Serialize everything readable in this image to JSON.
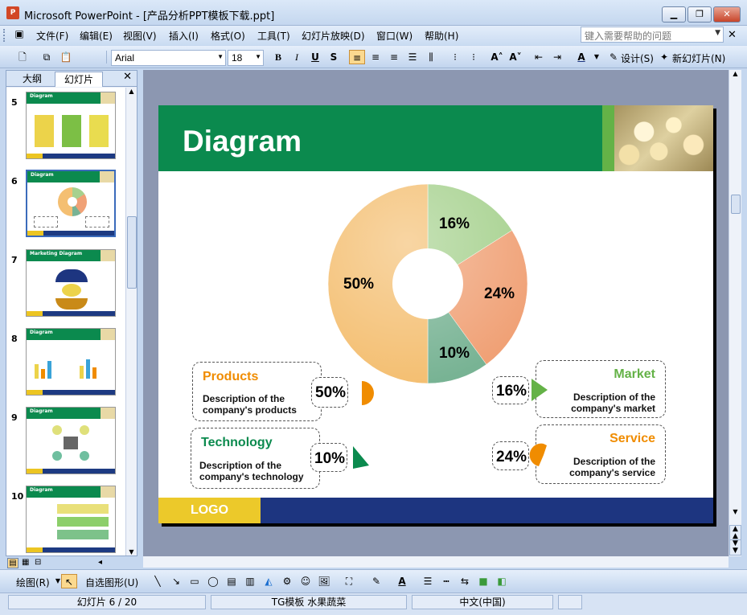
{
  "window": {
    "title": "Microsoft PowerPoint - [产品分析PPT模板下载.ppt]",
    "min": "▁",
    "max": "❐",
    "close": "✕",
    "app_icon_letter": "P"
  },
  "menu": {
    "items": [
      "文件(F)",
      "编辑(E)",
      "视图(V)",
      "插入(I)",
      "格式(O)",
      "工具(T)",
      "幻灯片放映(D)",
      "窗口(W)",
      "帮助(H)"
    ],
    "help_placeholder": "键入需要帮助的问题",
    "close": "✕"
  },
  "toolbar": {
    "font": "Arial",
    "size": "18",
    "bold": "B",
    "italic": "I",
    "underline": "U",
    "shadow": "S",
    "design_label": "设计(S)",
    "new_slide_label": "新幻灯片(N)"
  },
  "pane": {
    "tab_outline": "大纲",
    "tab_slides": "幻灯片",
    "close": "✕",
    "numbers": [
      "5",
      "6",
      "7",
      "8",
      "9",
      "10"
    ],
    "selected": "6",
    "headers": [
      "Diagram",
      "Diagram",
      "Marketing Diagram",
      "Diagram",
      "Diagram",
      "Diagram"
    ]
  },
  "slide": {
    "title": "Diagram",
    "logo": "LOGO",
    "donut_labels": [
      "16%",
      "24%",
      "10%",
      "50%"
    ],
    "callouts": {
      "products": {
        "title": "Products",
        "desc1": "Description of the",
        "desc2": "company's products",
        "pct": "50%"
      },
      "technology": {
        "title": "Technology",
        "desc1": "Description of the",
        "desc2": "company's technology",
        "pct": "10%"
      },
      "market": {
        "title": "Market",
        "desc1": "Description of the",
        "desc2": "company's market",
        "pct": "16%"
      },
      "service": {
        "title": "Service",
        "desc1": "Description of the",
        "desc2": "company's service",
        "pct": "24%"
      }
    },
    "colors": {
      "green": "#0b8a4e",
      "light_green": "#64b247",
      "orange": "#f08c00",
      "blue": "#1d3580",
      "yellow": "#ecc92a"
    }
  },
  "chart_data": {
    "type": "pie",
    "categories": [
      "Market",
      "Service",
      "Technology",
      "Products"
    ],
    "values": [
      16,
      24,
      10,
      50
    ],
    "colors": [
      "#a6d18e",
      "#f0a176",
      "#78b394",
      "#f4bf72"
    ]
  },
  "drawbar": {
    "draw": "绘图(R)",
    "autoshapes": "自选图形(U)"
  },
  "status": {
    "slide": "幻灯片 6 / 20",
    "template": "TG模板 水果蔬菜",
    "language": "中文(中国)"
  }
}
